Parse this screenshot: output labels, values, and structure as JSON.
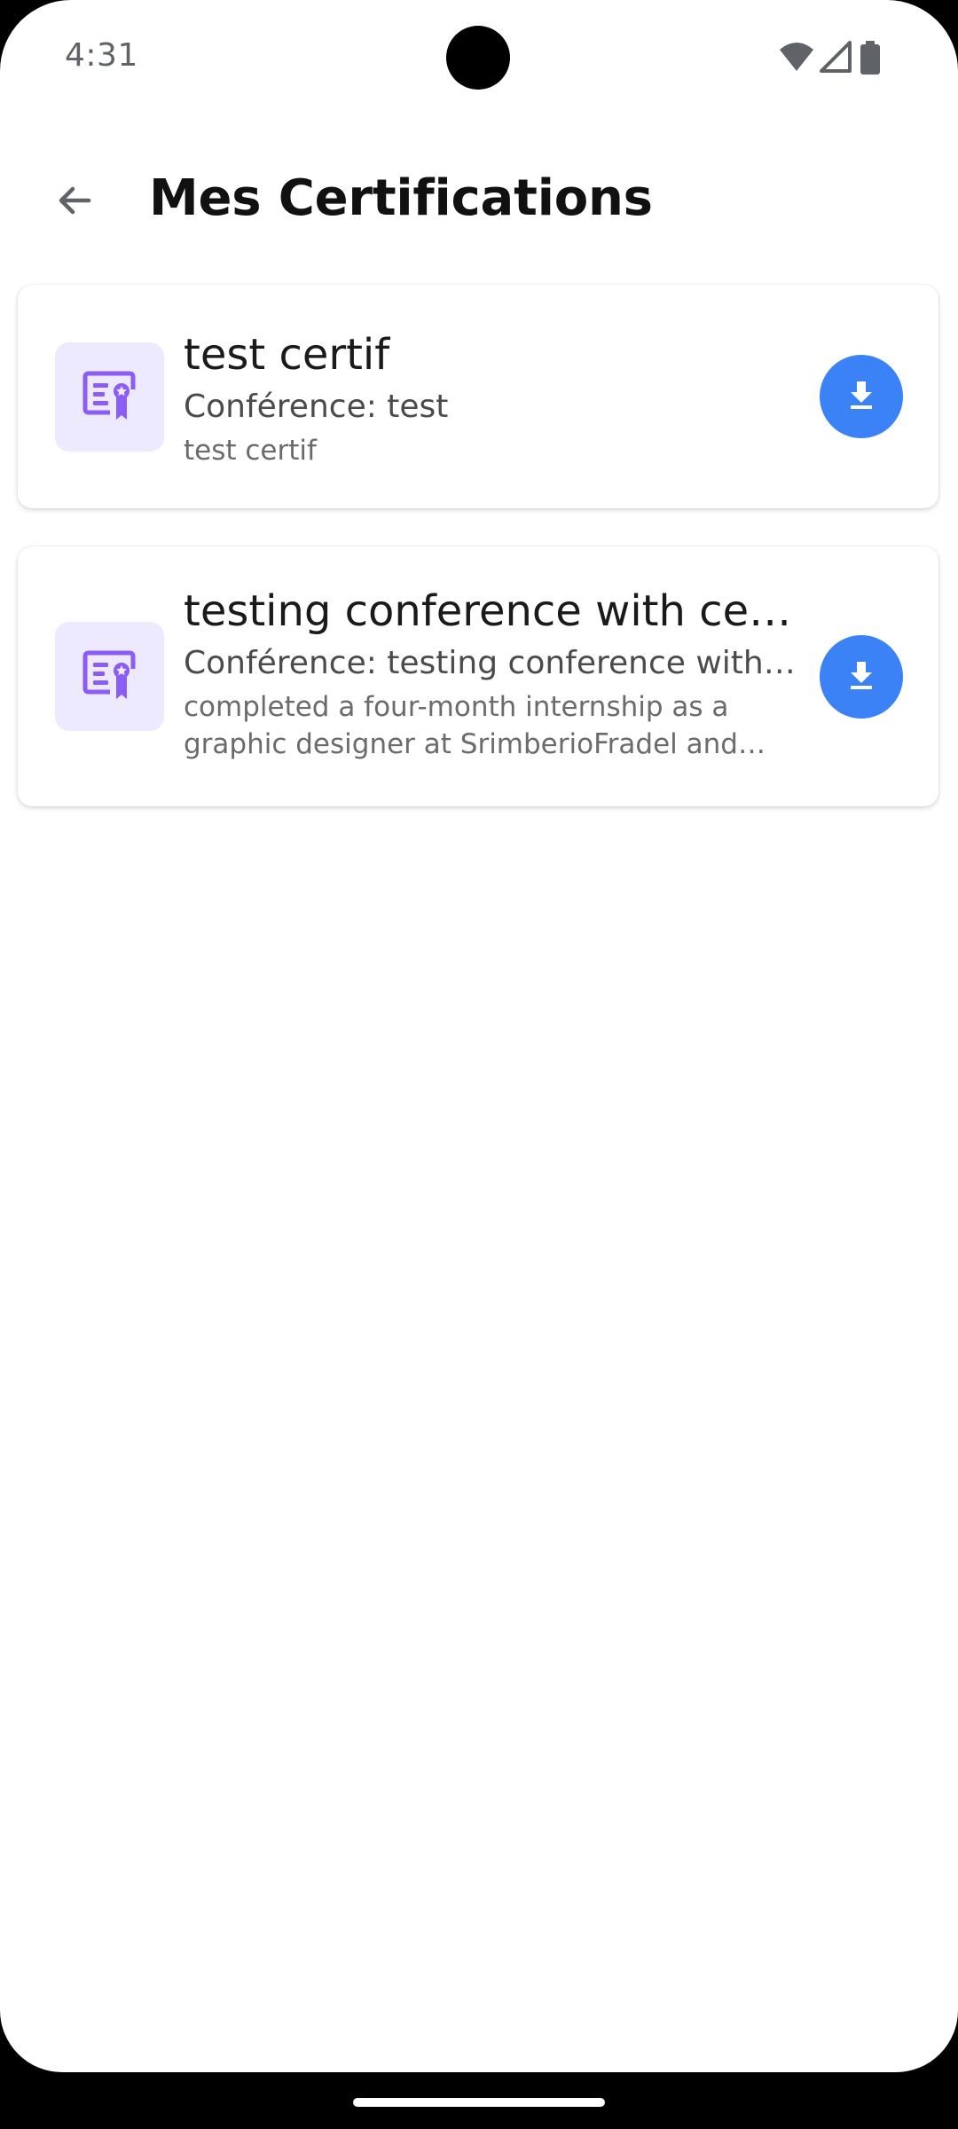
{
  "status_bar": {
    "time": "4:31",
    "icons": [
      "wifi-icon",
      "signal-icon",
      "battery-icon"
    ]
  },
  "app_bar": {
    "back_icon": "arrow-left-icon",
    "title": "Mes Certifications"
  },
  "certifications": [
    {
      "icon": "certificate-icon",
      "title": "test certif",
      "conference": "Conférence: test",
      "description": "test certif",
      "action_icon": "download-icon"
    },
    {
      "icon": "certificate-icon",
      "title": "testing conference with certi...",
      "conference": "Conférence: testing conference with c...",
      "description": "completed a four-month internship as a graphic designer at SrimberioFradel and Spi...",
      "action_icon": "download-icon"
    }
  ],
  "colors": {
    "accent": "#3b82f6",
    "icon_purple": "#8b5cf6",
    "icon_bg": "#ede9fe"
  }
}
